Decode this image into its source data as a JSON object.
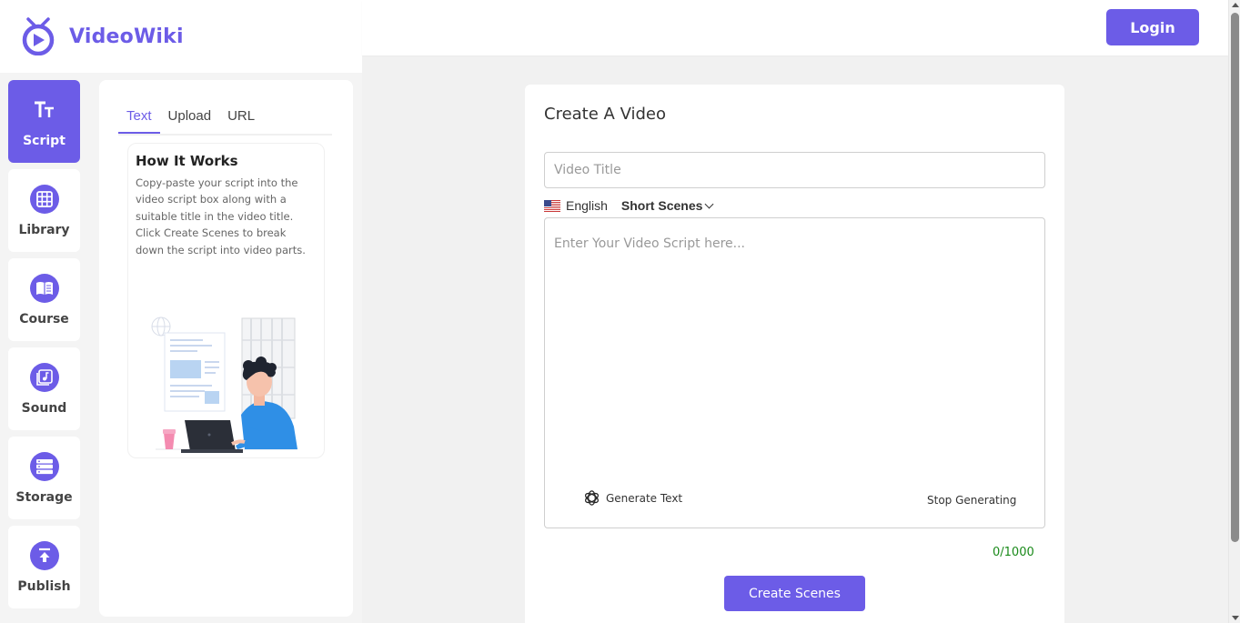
{
  "app": {
    "name": "VideoWiki"
  },
  "header": {
    "login_label": "Login"
  },
  "nav": {
    "items": [
      {
        "label": "Script",
        "icon": "text-size-icon",
        "active": true
      },
      {
        "label": "Library",
        "icon": "grid-icon"
      },
      {
        "label": "Course",
        "icon": "book-icon"
      },
      {
        "label": "Sound",
        "icon": "music-note-icon"
      },
      {
        "label": "Storage",
        "icon": "storage-icon"
      },
      {
        "label": "Publish",
        "icon": "upload-icon"
      }
    ]
  },
  "panel": {
    "tabs": [
      {
        "label": "Text",
        "active": true
      },
      {
        "label": "Upload"
      },
      {
        "label": "URL"
      }
    ],
    "how_it_works": {
      "title": "How It Works",
      "description": "Copy-paste your script into the video script box along with a suitable title in the video title. Click Create Scenes to break down the script into video parts."
    }
  },
  "main": {
    "title": "Create A Video",
    "video_title_placeholder": "Video Title",
    "language": "English",
    "scene_mode": "Short Scenes",
    "script_placeholder": "Enter Your Video Script here...",
    "generate_label": "Generate Text",
    "stop_label": "Stop Generating",
    "char_count": "0/1000",
    "create_label": "Create Scenes"
  },
  "colors": {
    "accent": "#6c5ce7",
    "counter": "#1a8a1a"
  }
}
